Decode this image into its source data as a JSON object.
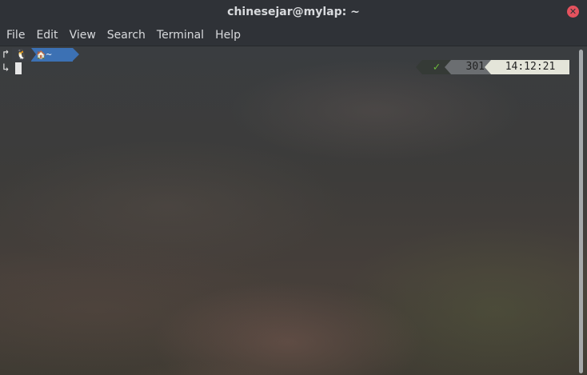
{
  "window": {
    "title": "chinesejar@mylap: ~",
    "close_icon": "✕"
  },
  "menu": {
    "items": [
      "File",
      "Edit",
      "View",
      "Search",
      "Terminal",
      "Help"
    ]
  },
  "prompt": {
    "line1_arrow": "↱",
    "line2_arrow": "↳",
    "os_icon": "🐧",
    "home_icon": "🏠",
    "path": "~",
    "status_icon": "✓",
    "history_number": "301",
    "time": "14:12:21"
  },
  "colors": {
    "path_segment": "#3c71b4",
    "status_ok": "#6dbb3b",
    "history_segment": "#6b6e71",
    "time_segment": "#e4e5d9",
    "close_button": "#e5525e"
  }
}
